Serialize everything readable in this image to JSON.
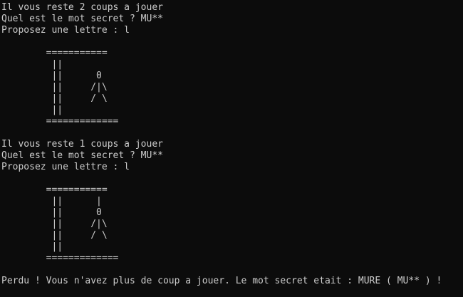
{
  "console": {
    "background": "#0c0c0c",
    "foreground": "#cccccc",
    "round1": {
      "remaining": "Il vous reste 2 coups a jouer",
      "question": "Quel est le mot secret ? MU**",
      "prompt": "Proposez une lettre : l",
      "gallows": [
        "        ===========",
        "         ||",
        "         ||      0",
        "         ||     /|\\",
        "         ||     / \\",
        "         ||",
        "        ============="
      ]
    },
    "round2": {
      "remaining": "Il vous reste 1 coups a jouer",
      "question": "Quel est le mot secret ? MU**",
      "prompt": "Proposez une lettre : l",
      "gallows": [
        "        ===========",
        "         ||      |",
        "         ||      0",
        "         ||     /|\\",
        "         ||     / \\",
        "         ||",
        "        ============="
      ]
    },
    "final_message": "Perdu ! Vous n'avez plus de coup a jouer. Le mot secret etait : MURE ( MU** ) !"
  }
}
